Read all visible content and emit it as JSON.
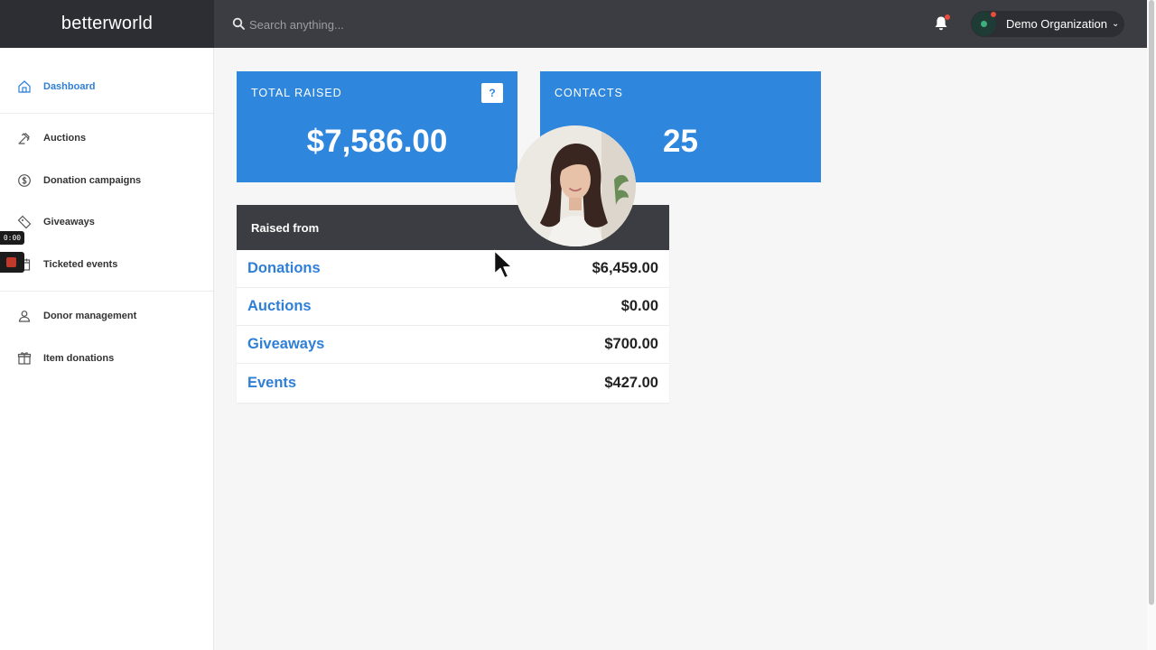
{
  "brand": {
    "name": "betterworld"
  },
  "topbar": {
    "search_placeholder": "Search anything...",
    "org_name": "Demo Organization"
  },
  "sidebar": {
    "items": [
      {
        "label": "Dashboard",
        "icon": "home-icon",
        "active": true
      },
      {
        "label": "Auctions",
        "icon": "gavel-icon"
      },
      {
        "label": "Donation campaigns",
        "icon": "dollar-coin-icon"
      },
      {
        "label": "Giveaways",
        "icon": "ticket-icon"
      },
      {
        "label": "Ticketed events",
        "icon": "calendar-icon"
      },
      {
        "label": "Donor management",
        "icon": "people-icon"
      },
      {
        "label": "Item donations",
        "icon": "gift-box-icon"
      }
    ]
  },
  "recorder": {
    "time": "0:00"
  },
  "cards": {
    "total_raised": {
      "title": "TOTAL RAISED",
      "value": "$7,586.00",
      "help": "?"
    },
    "contacts": {
      "title": "CONTACTS",
      "value": "25"
    }
  },
  "raised_from": {
    "title": "Raised from",
    "rows": [
      {
        "label": "Donations",
        "value": "$6,459.00"
      },
      {
        "label": "Auctions",
        "value": "$0.00"
      },
      {
        "label": "Giveaways",
        "value": "$700.00"
      },
      {
        "label": "Events",
        "value": "$427.00"
      }
    ]
  },
  "colors": {
    "accent": "#2f86dd",
    "link": "#2f7fd6",
    "topbar": "#3b3d42",
    "brand_bg": "#2c2e33"
  }
}
